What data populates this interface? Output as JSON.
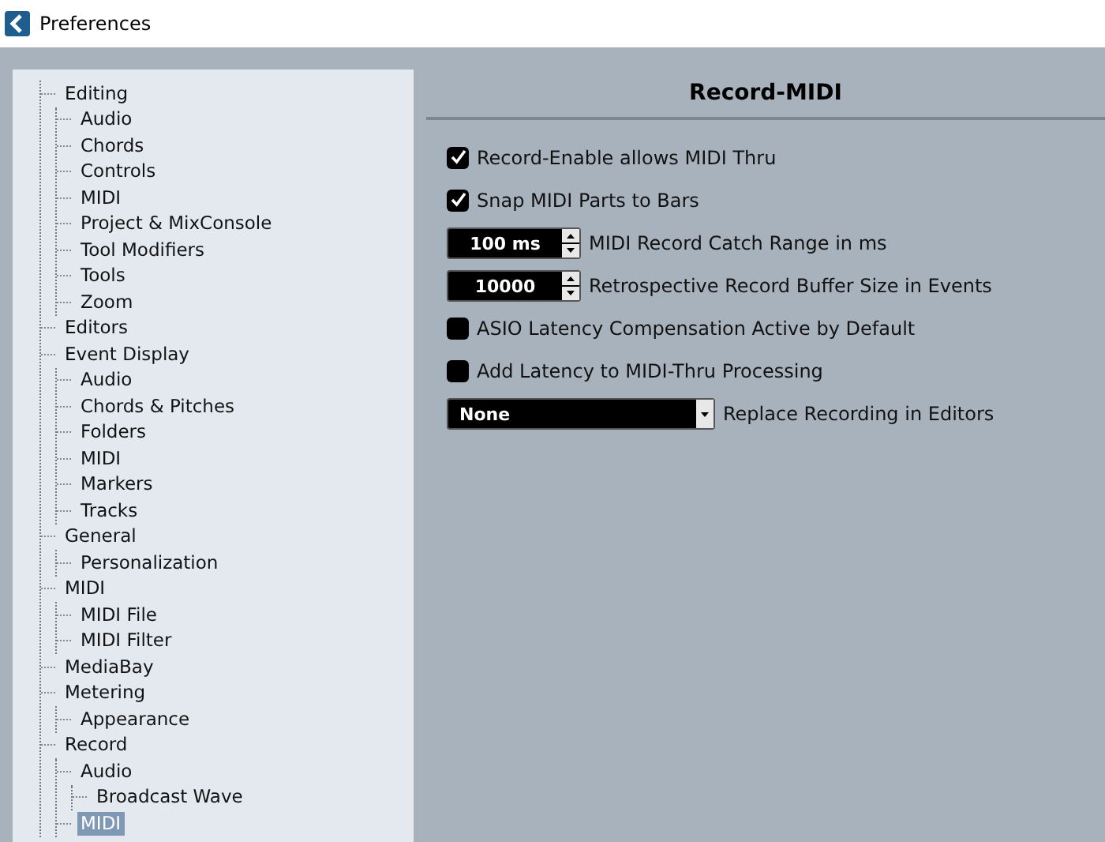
{
  "window": {
    "title": "Preferences"
  },
  "tree": [
    {
      "label": "Editing",
      "selected": false,
      "children": [
        {
          "label": "Audio",
          "selected": false
        },
        {
          "label": "Chords",
          "selected": false
        },
        {
          "label": "Controls",
          "selected": false
        },
        {
          "label": "MIDI",
          "selected": false
        },
        {
          "label": "Project & MixConsole",
          "selected": false
        },
        {
          "label": "Tool Modifiers",
          "selected": false
        },
        {
          "label": "Tools",
          "selected": false
        },
        {
          "label": "Zoom",
          "selected": false
        }
      ]
    },
    {
      "label": "Editors",
      "selected": false
    },
    {
      "label": "Event Display",
      "selected": false,
      "children": [
        {
          "label": "Audio",
          "selected": false
        },
        {
          "label": "Chords & Pitches",
          "selected": false
        },
        {
          "label": "Folders",
          "selected": false
        },
        {
          "label": "MIDI",
          "selected": false
        },
        {
          "label": "Markers",
          "selected": false
        },
        {
          "label": "Tracks",
          "selected": false
        }
      ]
    },
    {
      "label": "General",
      "selected": false,
      "children": [
        {
          "label": "Personalization",
          "selected": false
        }
      ]
    },
    {
      "label": "MIDI",
      "selected": false,
      "children": [
        {
          "label": "MIDI File",
          "selected": false
        },
        {
          "label": "MIDI Filter",
          "selected": false
        }
      ]
    },
    {
      "label": "MediaBay",
      "selected": false
    },
    {
      "label": "Metering",
      "selected": false,
      "children": [
        {
          "label": "Appearance",
          "selected": false
        }
      ]
    },
    {
      "label": "Record",
      "selected": false,
      "children": [
        {
          "label": "Audio",
          "selected": false,
          "children": [
            {
              "label": "Broadcast Wave",
              "selected": false
            }
          ]
        },
        {
          "label": "MIDI",
          "selected": true
        }
      ]
    }
  ],
  "panel": {
    "title": "Record-MIDI",
    "settings": [
      {
        "kind": "checkbox",
        "label": "Record-Enable allows MIDI Thru",
        "checked": true
      },
      {
        "kind": "checkbox",
        "label": "Snap MIDI Parts to Bars",
        "checked": true
      },
      {
        "kind": "spinner",
        "field": "100 ms",
        "label": "MIDI Record Catch Range in ms"
      },
      {
        "kind": "spinner",
        "field": "10000",
        "label": "Retrospective Record Buffer Size in Events"
      },
      {
        "kind": "checkbox",
        "label": "ASIO Latency Compensation Active by Default",
        "checked": false
      },
      {
        "kind": "checkbox",
        "label": "Add Latency to MIDI-Thru Processing",
        "checked": false
      },
      {
        "kind": "dropdown",
        "field": "None",
        "label": "Replace Recording in Editors"
      }
    ]
  }
}
